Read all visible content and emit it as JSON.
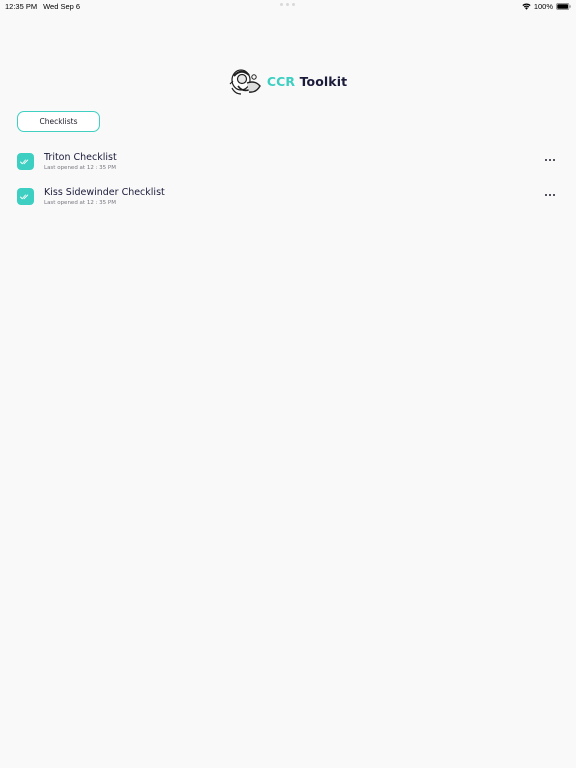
{
  "status_bar": {
    "time": "12:35 PM",
    "date": "Wed Sep 6",
    "battery": "100%",
    "icons": [
      "wifi-icon",
      "battery-icon"
    ]
  },
  "header": {
    "title_accent": "CCR",
    "title_rest": "Toolkit",
    "logo_icon": "diver-logo-icon"
  },
  "tabs": [
    {
      "label": "Checklists",
      "active": true
    }
  ],
  "checklists": [
    {
      "title": "Triton Checklist",
      "subtitle": "Last opened at 12 : 35  PM"
    },
    {
      "title": "Kiss Sidewinder Checklist",
      "subtitle": "Last opened at 12 : 35  PM"
    }
  ],
  "colors": {
    "accent": "#3dcfc1",
    "title_dark": "#1b1b3a",
    "background": "#f9f9fa"
  }
}
